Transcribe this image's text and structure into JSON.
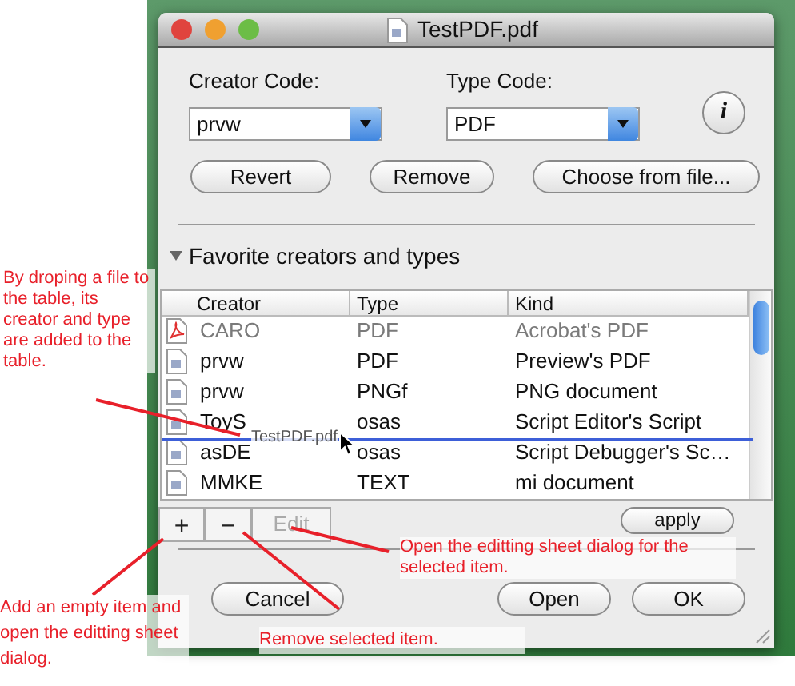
{
  "window": {
    "title": "TestPDF.pdf"
  },
  "creator_code": {
    "label": "Creator Code:",
    "value": "prvw"
  },
  "type_code": {
    "label": "Type Code:",
    "value": "PDF"
  },
  "info_button": {
    "label": "i"
  },
  "actions": [
    "Revert",
    "Remove",
    "Choose from file..."
  ],
  "section": {
    "title": "Favorite creators and types",
    "expanded": true
  },
  "table": {
    "columns": [
      "Creator",
      "Type",
      "Kind"
    ],
    "rows": [
      {
        "creator": "CARO",
        "type": "PDF",
        "kind": "Acrobat's PDF",
        "disabled": true
      },
      {
        "creator": "prvw",
        "type": "PDF",
        "kind": "Preview's PDF",
        "disabled": false
      },
      {
        "creator": "prvw",
        "type": "PNGf",
        "kind": "PNG document",
        "disabled": false
      },
      {
        "creator": "ToyS",
        "type": "osas",
        "kind": "Script Editor's Script",
        "disabled": false
      },
      {
        "creator": "asDE",
        "type": "osas",
        "kind": "Script Debugger's Sc…",
        "disabled": false
      },
      {
        "creator": "MMKE",
        "type": "TEXT",
        "kind": "mi document",
        "disabled": false
      }
    ]
  },
  "drag": {
    "filename": "TestPDF.pdf"
  },
  "list_buttons": [
    {
      "label": "+",
      "disabled": false
    },
    {
      "label": "−",
      "disabled": false
    },
    {
      "label": "Edit",
      "disabled": true
    }
  ],
  "apply_button": "apply",
  "footer_buttons": [
    "Cancel",
    "Open",
    "OK"
  ],
  "annotations": [
    {
      "text": "By droping a file to the table, its creator and type are added to the table."
    },
    {
      "text": "Open the editting sheet dialog for the selected item."
    },
    {
      "text": "Add an empty item and open the editting sheet dialog."
    },
    {
      "text": "Remove selected item."
    }
  ]
}
